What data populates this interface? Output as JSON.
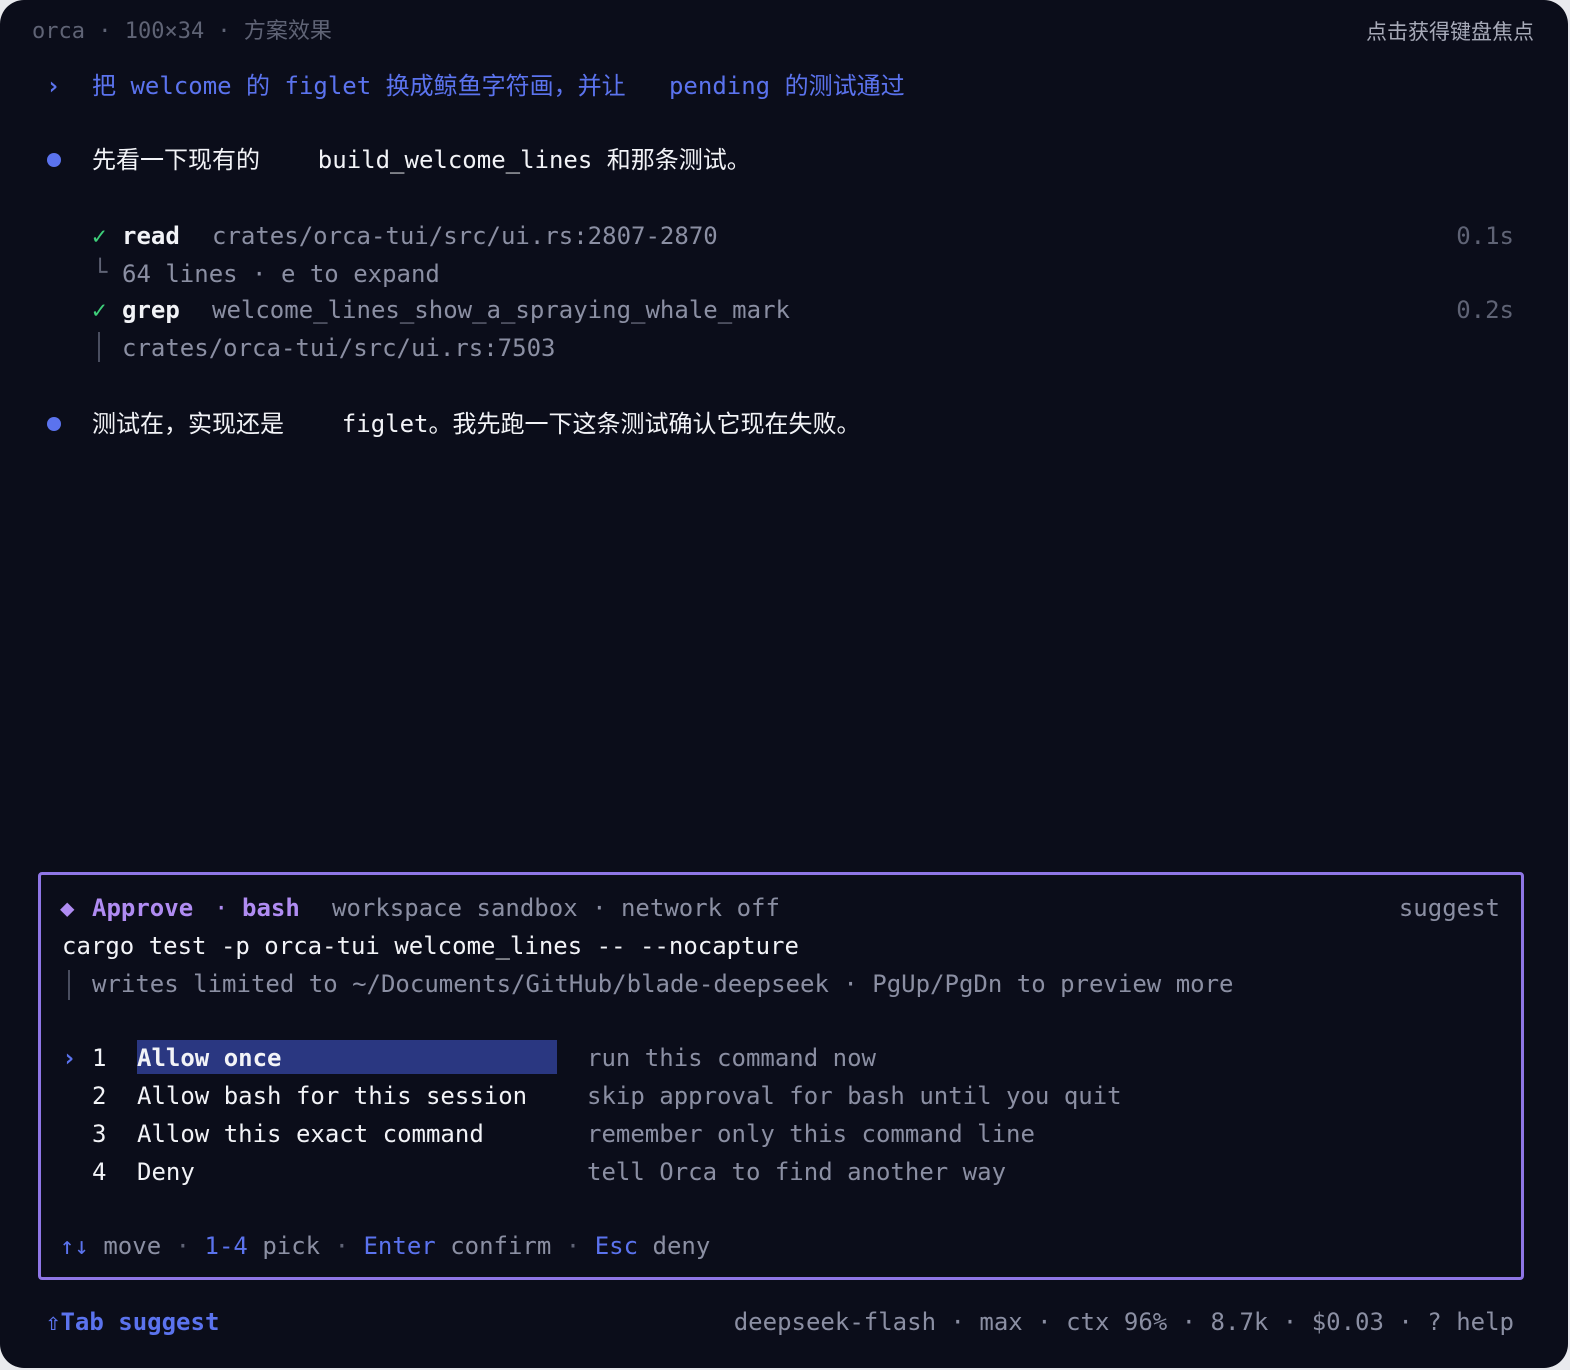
{
  "titlebar": {
    "left": "orca · 100×34 · 方案效果",
    "right": "点击获得键盘焦点"
  },
  "prompt": {
    "marker": "›",
    "text": "把 welcome 的 figlet 换成鲸鱼字符画，并让   pending 的测试通过"
  },
  "messages": [
    {
      "prefix": "先看一下现有的",
      "code": "build_welcome_lines",
      "suffix": "和那条测试。"
    },
    {
      "prefix": "测试在，实现还是",
      "code": "figlet",
      "suffix": "。我先跑一下这条测试确认它现在失败。"
    }
  ],
  "tools": [
    {
      "check": "✓",
      "name": "read",
      "arg": "crates/orca-tui/src/ui.rs:2807-2870",
      "time": "0.1s",
      "sub_marker": "└",
      "sub": "64 lines · e to expand"
    },
    {
      "check": "✓",
      "name": "grep",
      "arg": "welcome_lines_show_a_spraying_whale_mark",
      "time": "0.2s",
      "sub_marker": "│",
      "sub": "crates/orca-tui/src/ui.rs:7503"
    }
  ],
  "approval": {
    "diamond": "◆",
    "title": "Approve",
    "sep": "·",
    "tool": "bash",
    "info": "workspace sandbox · network off",
    "right": "suggest",
    "command": "cargo test -p orca-tui welcome_lines -- --nocapture",
    "note": "writes limited to ~/Documents/GitHub/blade-deepseek · PgUp/PgDn to preview more",
    "cursor": "›",
    "options": [
      {
        "num": "1",
        "label": "Allow once",
        "desc": "run this command now"
      },
      {
        "num": "2",
        "label": "Allow bash for this session",
        "desc": "skip approval for bash until you quit"
      },
      {
        "num": "3",
        "label": "Allow this exact command",
        "desc": "remember only this command line"
      },
      {
        "num": "4",
        "label": "Deny",
        "desc": "tell Orca to find another way"
      }
    ],
    "hints": {
      "arrows": "↑↓",
      "move": "move",
      "pick_key": "1-4",
      "pick": "pick",
      "enter_key": "Enter",
      "confirm": "confirm",
      "esc_key": "Esc",
      "deny": "deny",
      "dot": "·"
    }
  },
  "statusbar": {
    "left_key": "⇧Tab",
    "left_label": "suggest",
    "right": "deepseek-flash · max · ctx 96% · 8.7k · $0.03 · ? help"
  }
}
